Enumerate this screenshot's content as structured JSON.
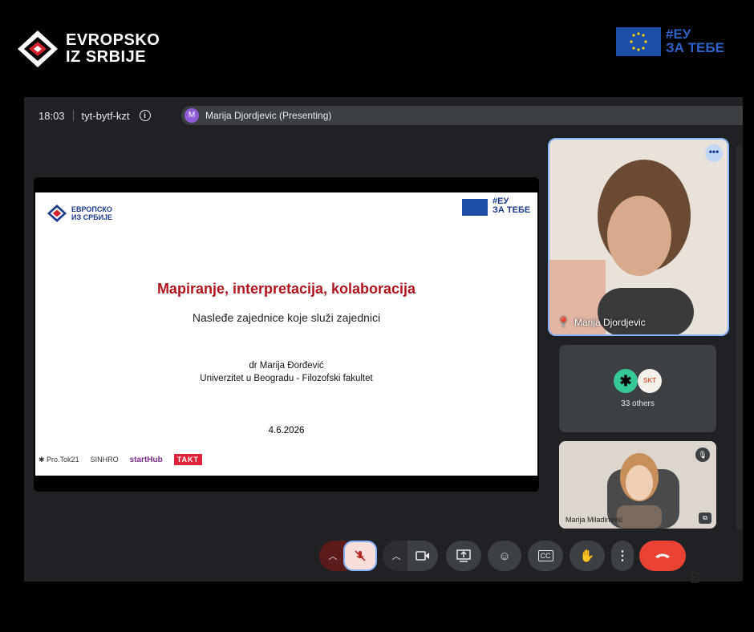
{
  "branding": {
    "line1": "EVROPSKO",
    "line2": "IZ SRBIJE",
    "eu_line1": "#ЕУ",
    "eu_line2": "ЗА ТЕБЕ"
  },
  "meet": {
    "time": "18:03",
    "meeting_code": "tyt-bytf-kzt",
    "presenter_initial": "M",
    "presenter_label": "Marija Djordjevic (Presenting)"
  },
  "slide": {
    "brand_line1": "ЕВРОПСКО",
    "brand_line2": "ИЗ СРБИЈЕ",
    "eu_line1": "#ЕУ",
    "eu_line2": "ЗА ТЕБЕ",
    "title": "Mapiranje, interpretacija, kolaboracija",
    "subtitle": "Nasleđe zajednice koje služi zajednici",
    "author": "dr Marija Đorđević",
    "affiliation": "Univerzitet u Beogradu - Filozofski fakultet",
    "date": "4.6.2026",
    "logo1": "Pro.Tok21",
    "logo2": "SINHRO",
    "logo3": "startHub",
    "logo4": "TAKT"
  },
  "participants": {
    "main_name": "Marija Djordjevic",
    "others_avatar1": "✱",
    "others_avatar2": "SKT",
    "others_label": "33 others",
    "third_name": "Marija Miladinović"
  },
  "colors": {
    "accent": "#8ab4f8",
    "hangup": "#ea4335",
    "mic_off": "#f9dedc"
  },
  "page_letter": "Б"
}
